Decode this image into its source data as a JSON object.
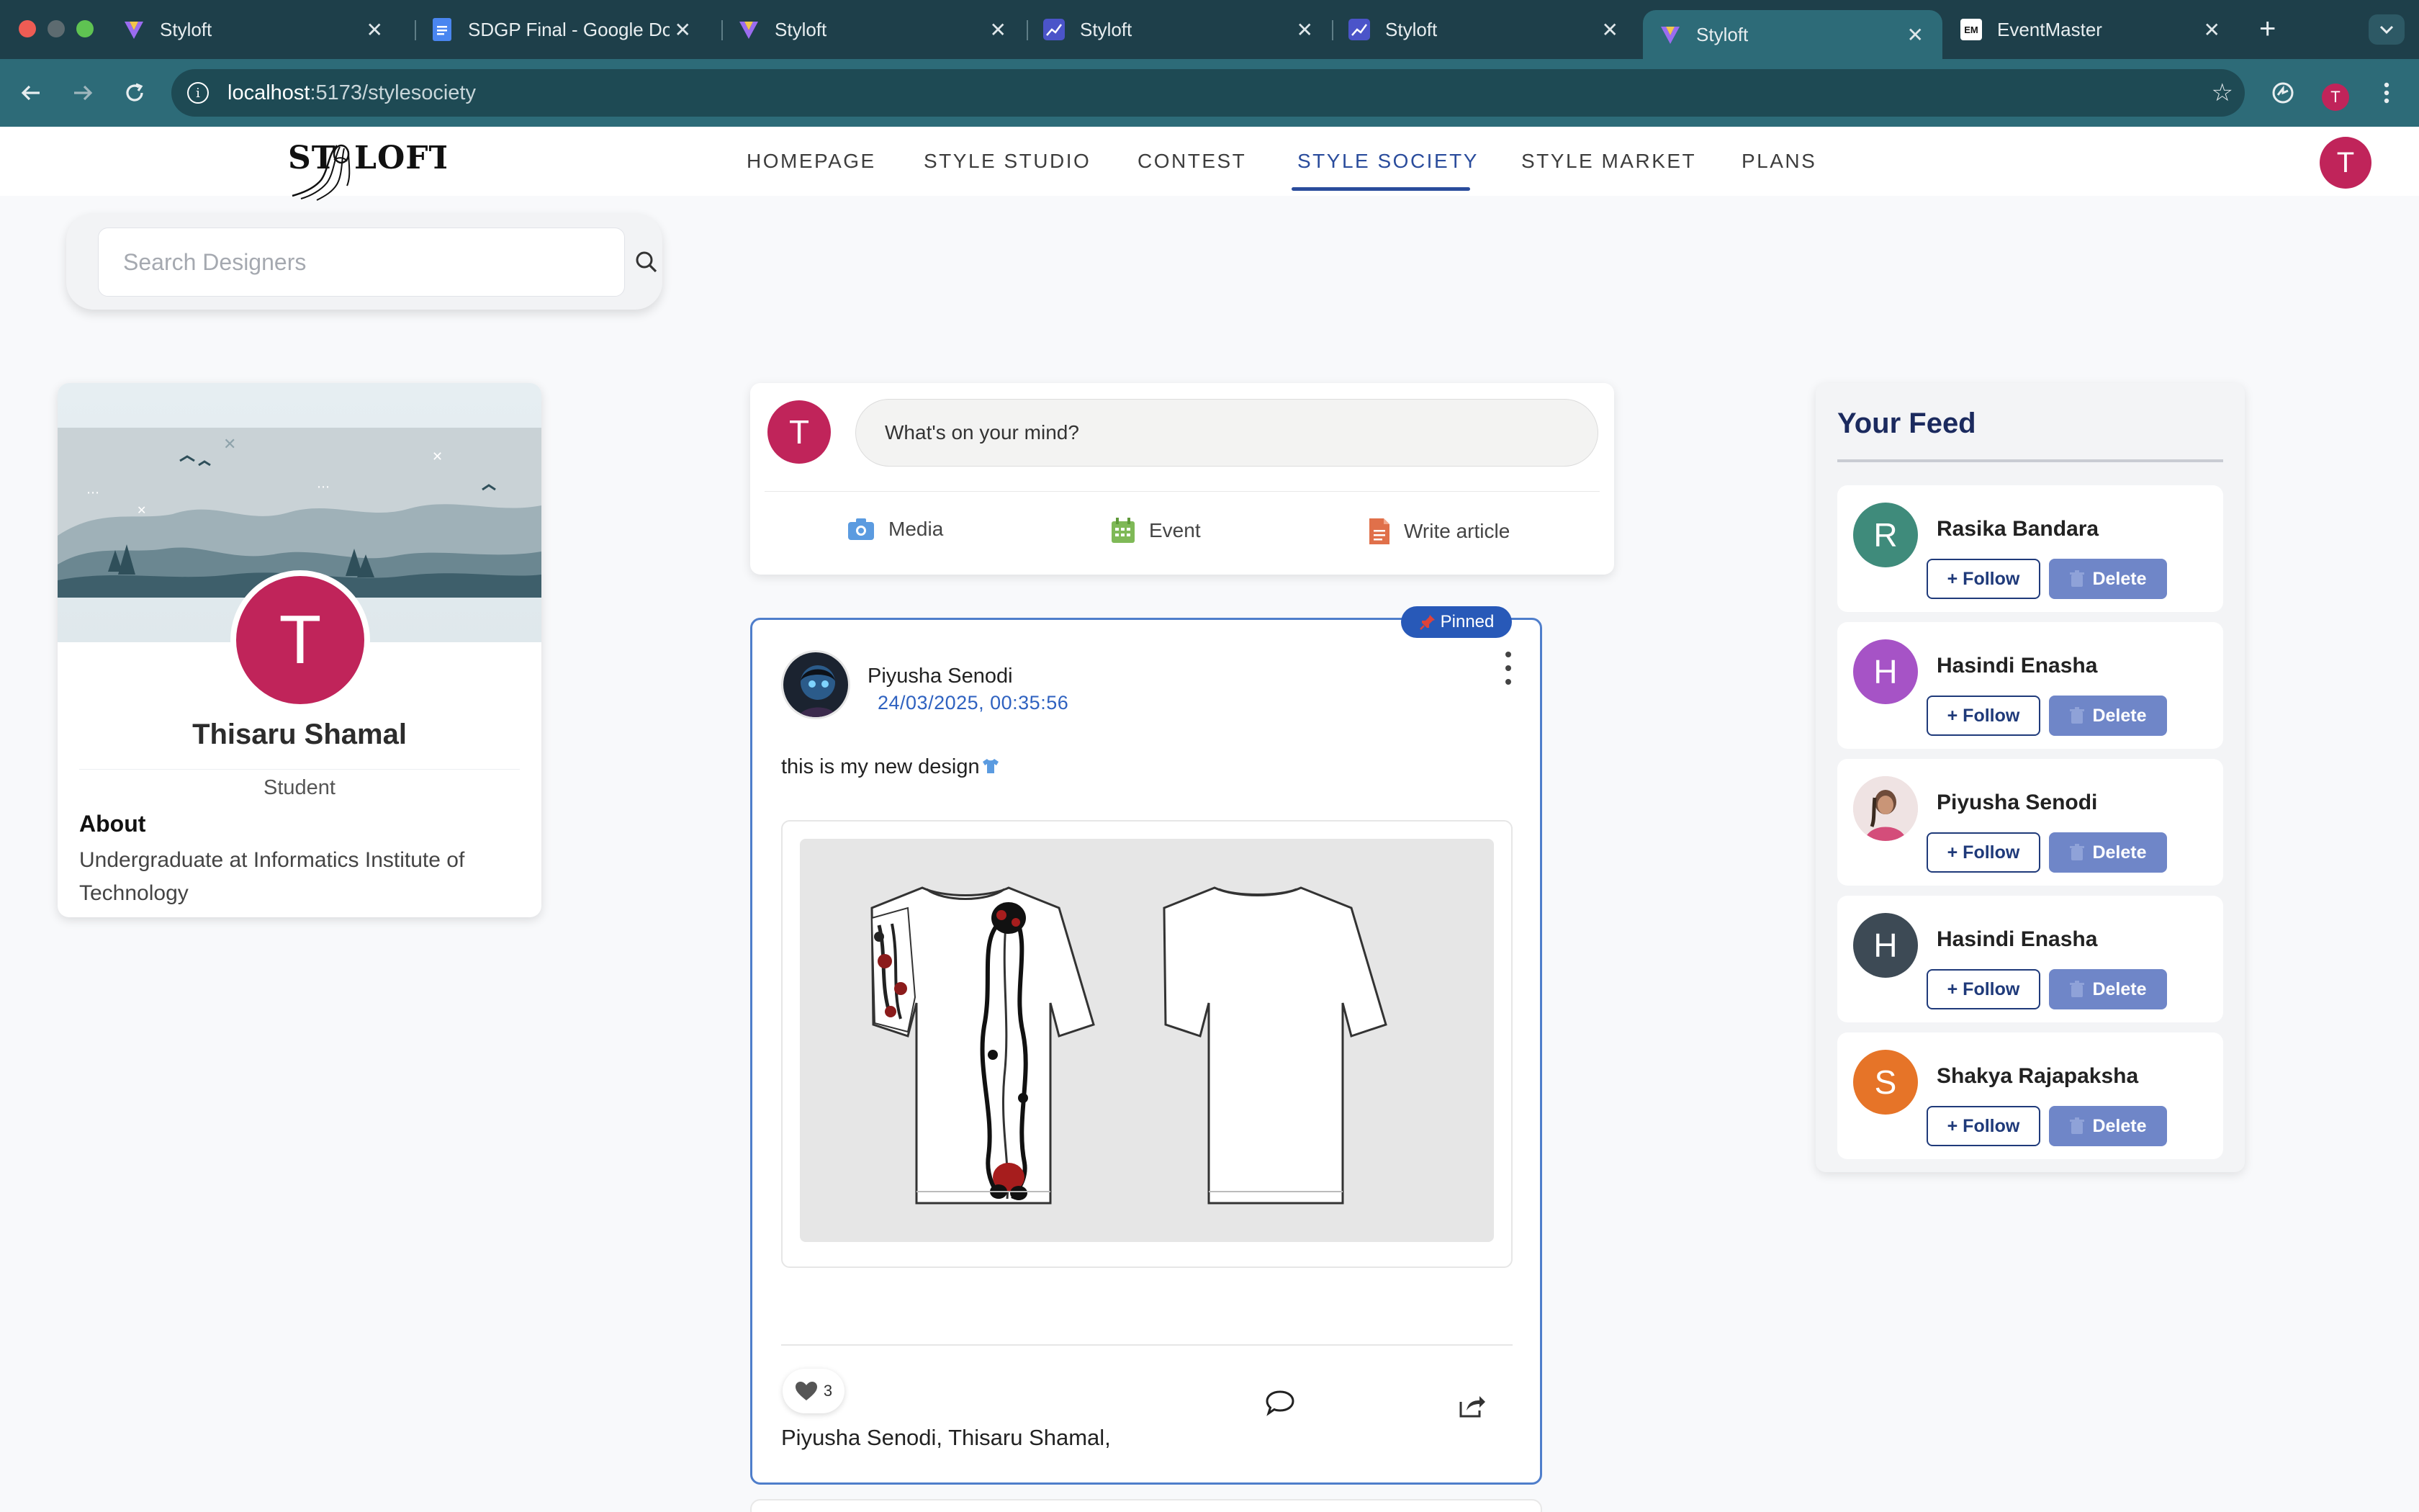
{
  "browser": {
    "tabs": [
      {
        "title": "Styloft"
      },
      {
        "title": "SDGP Final - Google Docs"
      },
      {
        "title": "Styloft"
      },
      {
        "title": "Styloft"
      },
      {
        "title": "Styloft"
      },
      {
        "title": "Styloft"
      },
      {
        "title": "EventMaster"
      }
    ],
    "active_tab": 5,
    "url_host": "localhost",
    "url_path": ":5173/stylesociety",
    "profile_initial": "T"
  },
  "header": {
    "logo_text": "STYLOFT",
    "nav": [
      "HOMEPAGE",
      "STYLE STUDIO",
      "CONTEST",
      "STYLE SOCIETY",
      "STYLE MARKET",
      "PLANS"
    ],
    "active_nav": "STYLE SOCIETY",
    "user_initial": "T"
  },
  "search": {
    "placeholder": "Search Designers"
  },
  "profile": {
    "initial": "T",
    "name": "Thisaru Shamal",
    "role": "Student",
    "about_heading": "About",
    "about_text": "Undergraduate at Informatics Institute of Technology"
  },
  "composer": {
    "initial": "T",
    "placeholder": "What's on your mind?",
    "actions": {
      "media": "Media",
      "event": "Event",
      "article": "Write article"
    }
  },
  "post": {
    "badge": "Pinned",
    "author": "Piyusha Senodi",
    "timestamp": "24/03/2025, 00:35:56",
    "text": "this is my new design",
    "likes": "3",
    "liked_by": "Piyusha Senodi, Thisaru Shamal,"
  },
  "feed": {
    "title": "Your Feed",
    "follow_label": "+ Follow",
    "delete_label": "Delete",
    "users": [
      {
        "initial": "R",
        "name": "Rasika Bandara",
        "color": "#3f8b7b"
      },
      {
        "initial": "H",
        "name": "Hasindi Enasha",
        "color": "#a653c6"
      },
      {
        "initial": "",
        "name": "Piyusha Senodi",
        "color": "#f0dada"
      },
      {
        "initial": "H",
        "name": "Hasindi Enasha",
        "color": "#3d4a55"
      },
      {
        "initial": "S",
        "name": "Shakya Rajapaksha",
        "color": "#e67428"
      }
    ]
  },
  "colors": {
    "accent": "#2a4c9c",
    "avatar": "#c0245a",
    "chrome": "#2d6b78"
  }
}
